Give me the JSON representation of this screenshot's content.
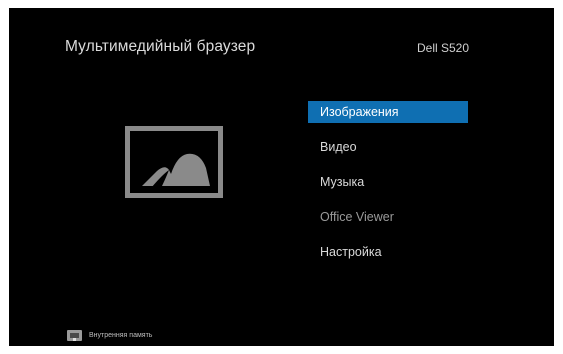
{
  "header": {
    "title": "Мультимедийный браузер",
    "device": "Dell S520"
  },
  "menu": {
    "items": [
      {
        "label": "Изображения",
        "selected": true
      },
      {
        "label": "Видео",
        "selected": false
      },
      {
        "label": "Музыка",
        "selected": false
      },
      {
        "label": "Office Viewer",
        "selected": false
      },
      {
        "label": "Настройка",
        "selected": false
      }
    ]
  },
  "preview": {
    "icon": "image-icon"
  },
  "footer": {
    "storage_icon": "storage-icon",
    "storage_label": "Внутренняя память"
  },
  "colors": {
    "background": "#000000",
    "accent": "#0f6fb2",
    "text": "#d9d9d9"
  }
}
